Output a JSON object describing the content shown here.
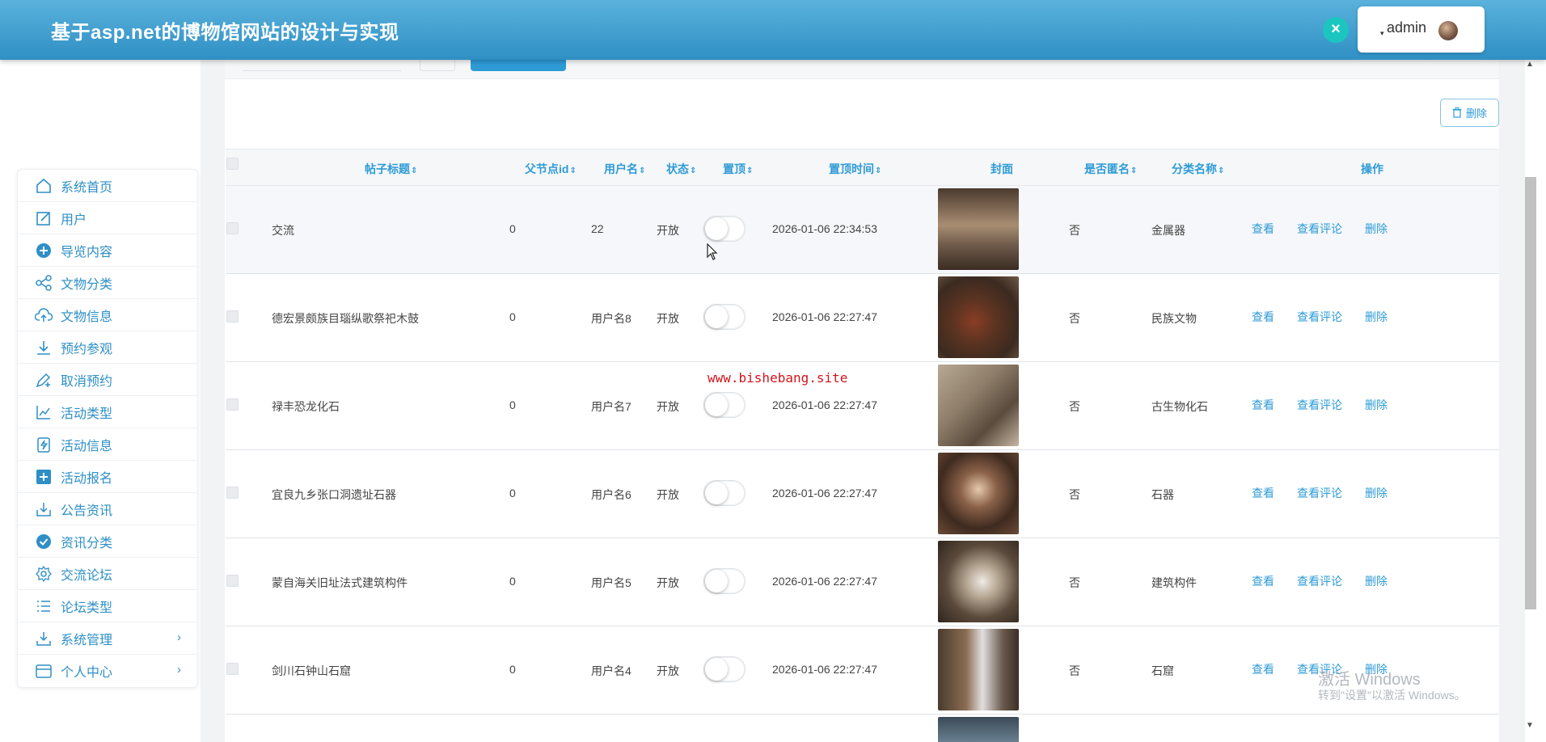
{
  "header": {
    "title": "基于asp.net的博物馆网站的设计与实现",
    "username": "admin",
    "accent_color": "#3a9bd5"
  },
  "sidebar": {
    "items": [
      {
        "label": "系统首页",
        "icon": "home-icon"
      },
      {
        "label": "用户",
        "icon": "edit-icon"
      },
      {
        "label": "导览内容",
        "icon": "plus-circle-icon"
      },
      {
        "label": "文物分类",
        "icon": "share-icon"
      },
      {
        "label": "文物信息",
        "icon": "cloud-upload-icon"
      },
      {
        "label": "预约参观",
        "icon": "download-icon"
      },
      {
        "label": "取消预约",
        "icon": "pen-add-icon"
      },
      {
        "label": "活动类型",
        "icon": "line-chart-icon"
      },
      {
        "label": "活动信息",
        "icon": "lightning-doc-icon"
      },
      {
        "label": "活动报名",
        "icon": "plus-square-icon"
      },
      {
        "label": "公告资讯",
        "icon": "inbox-download-icon"
      },
      {
        "label": "资讯分类",
        "icon": "check-circle-icon"
      },
      {
        "label": "交流论坛",
        "icon": "gear-icon"
      },
      {
        "label": "论坛类型",
        "icon": "list-icon"
      },
      {
        "label": "系统管理",
        "icon": "download-box-icon",
        "has_children": true
      },
      {
        "label": "个人中心",
        "icon": "card-icon",
        "has_children": true
      }
    ],
    "expand_arrow": "›"
  },
  "toolbar": {
    "delete_label": "删除"
  },
  "table": {
    "columns": [
      "帖子标题",
      "父节点id",
      "用户名",
      "状态",
      "置顶",
      "置顶时间",
      "封面",
      "是否匿名",
      "分类名称",
      "操作"
    ],
    "sort_glyph": "⇕",
    "actions": [
      "查看",
      "查看评论",
      "删除"
    ],
    "rows": [
      {
        "title": "交流",
        "parent_id": "0",
        "username": "22",
        "status": "开放",
        "pinned": false,
        "pin_time": "2026-01-06 22:34:53",
        "anonymous": "否",
        "category": "金属器"
      },
      {
        "title": "德宏景颇族目瑙纵歌祭祀木鼓",
        "parent_id": "0",
        "username": "用户名8",
        "status": "开放",
        "pinned": false,
        "pin_time": "2026-01-06 22:27:47",
        "anonymous": "否",
        "category": "民族文物"
      },
      {
        "title": "禄丰恐龙化石",
        "parent_id": "0",
        "username": "用户名7",
        "status": "开放",
        "pinned": false,
        "pin_time": "2026-01-06 22:27:47",
        "anonymous": "否",
        "category": "古生物化石"
      },
      {
        "title": "宜良九乡张口洞遗址石器",
        "parent_id": "0",
        "username": "用户名6",
        "status": "开放",
        "pinned": false,
        "pin_time": "2026-01-06 22:27:47",
        "anonymous": "否",
        "category": "石器"
      },
      {
        "title": "蒙自海关旧址法式建筑构件",
        "parent_id": "0",
        "username": "用户名5",
        "status": "开放",
        "pinned": false,
        "pin_time": "2026-01-06 22:27:47",
        "anonymous": "否",
        "category": "建筑构件"
      },
      {
        "title": "剑川石钟山石窟",
        "parent_id": "0",
        "username": "用户名4",
        "status": "开放",
        "pinned": false,
        "pin_time": "2026-01-06 22:27:47",
        "anonymous": "否",
        "category": "石窟"
      }
    ]
  },
  "watermark": "www.bishebang.site",
  "os_overlay": {
    "line1": "激活 Windows",
    "line2": "转到\"设置\"以激活 Windows。"
  }
}
